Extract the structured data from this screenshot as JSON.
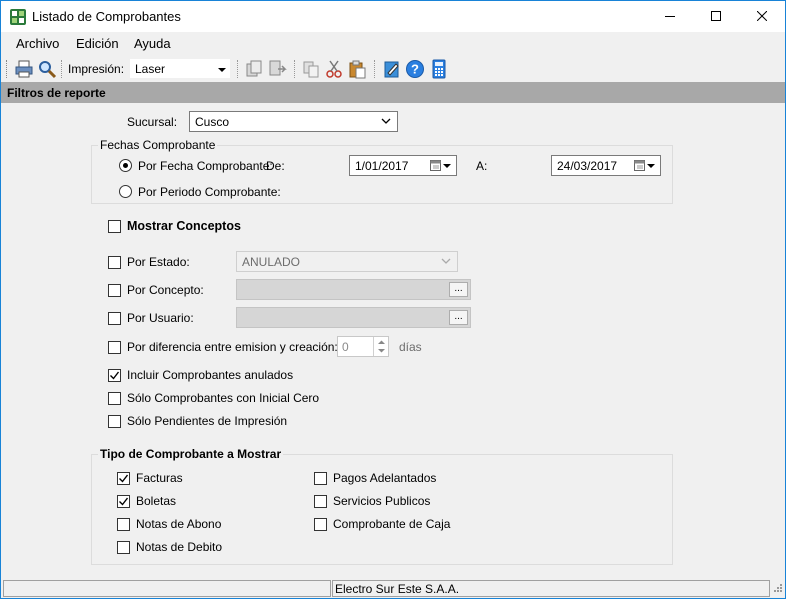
{
  "window": {
    "title": "Listado de Comprobantes"
  },
  "menu": {
    "items": [
      "Archivo",
      "Edición",
      "Ayuda"
    ]
  },
  "toolbar": {
    "impresion_label": "Impresión:",
    "printer_value": "Laser"
  },
  "section": {
    "title": "Filtros de reporte"
  },
  "sucursal": {
    "label": "Sucursal:",
    "value": "Cusco"
  },
  "fechas": {
    "group_title": "Fechas Comprobante",
    "por_fecha_label": "Por Fecha Comprobante:",
    "de_label": "De:",
    "de_value": "1/01/2017",
    "a_label": "A:",
    "a_value": "24/03/2017",
    "por_periodo_label": "Por Periodo Comprobante:",
    "por_fecha_selected": true
  },
  "filters": {
    "mostrar_conceptos": "Mostrar Conceptos",
    "por_estado": "Por Estado:",
    "estado_value": "ANULADO",
    "por_concepto": "Por Concepto:",
    "por_usuario": "Por Usuario:",
    "dots": "...",
    "por_diferencia": "Por diferencia entre emision y creación:",
    "diferencia_value": "0",
    "dias_label": "días",
    "incluir_anulados": "Incluir Comprobantes anulados",
    "incluir_anulados_checked": true,
    "solo_inicial_cero": "Sólo Comprobantes con Inicial Cero",
    "solo_pendientes": "Sólo Pendientes de Impresión"
  },
  "tipo": {
    "group_title": "Tipo de Comprobante a Mostrar",
    "facturas": "Facturas",
    "facturas_checked": true,
    "boletas": "Boletas",
    "boletas_checked": true,
    "notas_abono": "Notas de Abono",
    "notas_debito": "Notas de Debito",
    "pagos_adelantados": "Pagos Adelantados",
    "servicios_publicos": "Servicios Publicos",
    "comprobante_caja": "Comprobante de Caja"
  },
  "status": {
    "company": "Electro Sur Este S.A.A."
  },
  "colors": {
    "accent": "#1883d7",
    "header_bg": "#a8a8a8",
    "window_bg": "#f0f0f0"
  }
}
